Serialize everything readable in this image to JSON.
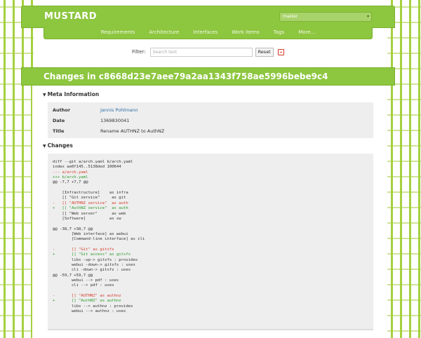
{
  "app": {
    "name": "MUSTARD"
  },
  "branch": {
    "selected": "master"
  },
  "nav": {
    "items": [
      "Requirements",
      "Architecture",
      "Interfaces",
      "Work Items",
      "Tags",
      "More..."
    ]
  },
  "filter": {
    "label": "Filter:",
    "placeholder": "Search text",
    "reset_label": "Reset"
  },
  "page": {
    "title": "Changes in c8668d23e7aee79a2aa1343f758ae5996bebe9c4"
  },
  "meta": {
    "heading": "Meta Information",
    "author_label": "Author",
    "author": "Jannis Pohlmann",
    "date_label": "Date",
    "date": "1369830041",
    "title_label": "Title",
    "title": "Rename AUTHNZ to AuthNZ"
  },
  "changes": {
    "heading": "Changes",
    "lines": [
      {
        "text": "diff --git a/arch.yaml b/arch.yaml",
        "type": "hdr"
      },
      {
        "text": "index ae0f145..5138ded 100644",
        "type": "hdr"
      },
      {
        "text": "--- a/arch.yaml",
        "type": "del"
      },
      {
        "text": "+++ b/arch.yaml",
        "type": "add"
      },
      {
        "text": "@@ -7,7 +7,7 @@",
        "type": "hdr"
      },
      {
        "text": "",
        "type": "hdr"
      },
      {
        "text": "    [Infrastructure]    as infra",
        "type": "hdr"
      },
      {
        "text": "    [] \"Git service\"     as git",
        "type": "hdr"
      },
      {
        "text": "-   [] \"AUTHNZ service\"  as auth",
        "type": "del"
      },
      {
        "text": "+   [] \"AuthNZ service\"  as auth",
        "type": "add"
      },
      {
        "text": "    [] \"Web server\"      as web",
        "type": "hdr"
      },
      {
        "text": "    [Software]          as sw",
        "type": "hdr"
      },
      {
        "text": "",
        "type": "hdr"
      },
      {
        "text": "@@ -38,7 +38,7 @@",
        "type": "hdr"
      },
      {
        "text": "        [Web interface] as webui",
        "type": "hdr"
      },
      {
        "text": "        [Command-line interface] as cli",
        "type": "hdr"
      },
      {
        "text": "",
        "type": "hdr"
      },
      {
        "text": "-       [] \"Git\" as gitsfs",
        "type": "del"
      },
      {
        "text": "+       [] \"Git access\" as gitsfs",
        "type": "add"
      },
      {
        "text": "        libs -up-> gitsfs : provides",
        "type": "hdr"
      },
      {
        "text": "        webui -down-> gitsfs : uses",
        "type": "hdr"
      },
      {
        "text": "        cli -down-> gitsfs : uses",
        "type": "hdr"
      },
      {
        "text": "@@ -59,7 +59,7 @@",
        "type": "hdr"
      },
      {
        "text": "        webui --> pdf : uses",
        "type": "hdr"
      },
      {
        "text": "        cli --> pdf : uses",
        "type": "hdr"
      },
      {
        "text": "",
        "type": "hdr"
      },
      {
        "text": "-       [] \"AUTHNZ\" as authnz",
        "type": "del"
      },
      {
        "text": "+       [] \"AuthNZ\" as authnz",
        "type": "add"
      },
      {
        "text": "        libs --> authnz : provides",
        "type": "hdr"
      },
      {
        "text": "        webui --> authnz : uses",
        "type": "hdr"
      }
    ]
  }
}
